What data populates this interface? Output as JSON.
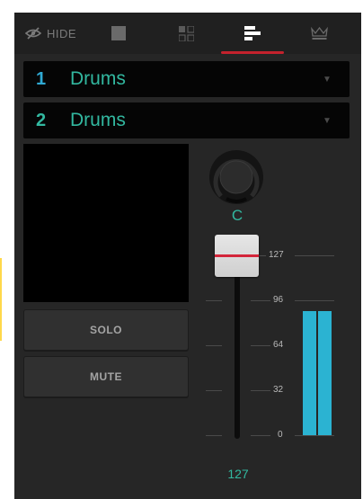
{
  "toolbar": {
    "hide_label": "HIDE",
    "tabs": [
      {
        "icon": "square-icon"
      },
      {
        "icon": "grid-icon"
      },
      {
        "icon": "mixer-bars-icon",
        "active": true
      },
      {
        "icon": "crown-icon"
      }
    ],
    "active_color": "#c4222d"
  },
  "tracks": [
    {
      "number": "1",
      "name": "Drums",
      "number_color": "#2fa9d3",
      "name_color": "#32b8a0"
    },
    {
      "number": "2",
      "name": "Drums",
      "number_color": "#32b8a0",
      "name_color": "#32b8a0"
    }
  ],
  "buttons": {
    "solo": "SOLO",
    "mute": "MUTE"
  },
  "pan_knob": {
    "label": "C"
  },
  "fader": {
    "value": "127",
    "scale": [
      "127",
      "96",
      "64",
      "32",
      "0"
    ],
    "cap_line_color": "#d3253a"
  },
  "meter": {
    "color": "#2bb3d2",
    "level_fraction": 0.72
  }
}
